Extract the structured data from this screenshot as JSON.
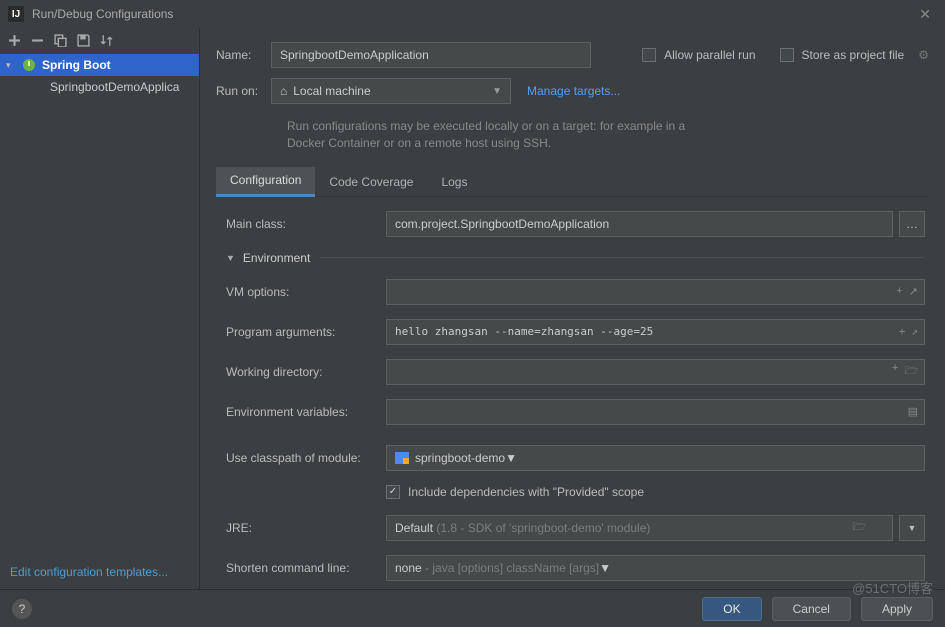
{
  "window": {
    "title": "Run/Debug Configurations"
  },
  "sidebar": {
    "group": "Spring Boot",
    "item": "SpringbootDemoApplica",
    "editTemplates": "Edit configuration templates..."
  },
  "topForm": {
    "nameLabel": "Name:",
    "nameValue": "SpringbootDemoApplication",
    "allowParallel": "Allow parallel run",
    "storeAsProject": "Store as project file",
    "runOnLabel": "Run on:",
    "runOnValue": "Local machine",
    "manageTargets": "Manage targets...",
    "hint": "Run configurations may be executed locally or on a target: for example in a Docker Container or on a remote host using SSH."
  },
  "tabs": {
    "configuration": "Configuration",
    "codeCoverage": "Code Coverage",
    "logs": "Logs"
  },
  "form": {
    "mainClassLabel": "Main class:",
    "mainClassValue": "com.project.SpringbootDemoApplication",
    "environmentSection": "Environment",
    "vmOptionsLabel": "VM options:",
    "vmOptionsValue": "",
    "programArgsLabel": "Program arguments:",
    "programArgsValue": "hello zhangsan --name=zhangsan --age=25",
    "workingDirLabel": "Working directory:",
    "workingDirValue": "",
    "envVarsLabel": "Environment variables:",
    "envVarsValue": "",
    "classpathLabel": "Use classpath of module:",
    "classpathValue": "springboot-demo",
    "includeProvided": "Include dependencies with \"Provided\" scope",
    "jreLabel": "JRE:",
    "jrePrefix": "Default",
    "jreHint": " (1.8 - SDK of 'springboot-demo' module)",
    "shortenLabel": "Shorten command line:",
    "shortenPrefix": "none",
    "shortenHint": " - java [options] className [args]"
  },
  "buttons": {
    "ok": "OK",
    "cancel": "Cancel",
    "apply": "Apply"
  },
  "watermark": "@51CTO博客"
}
